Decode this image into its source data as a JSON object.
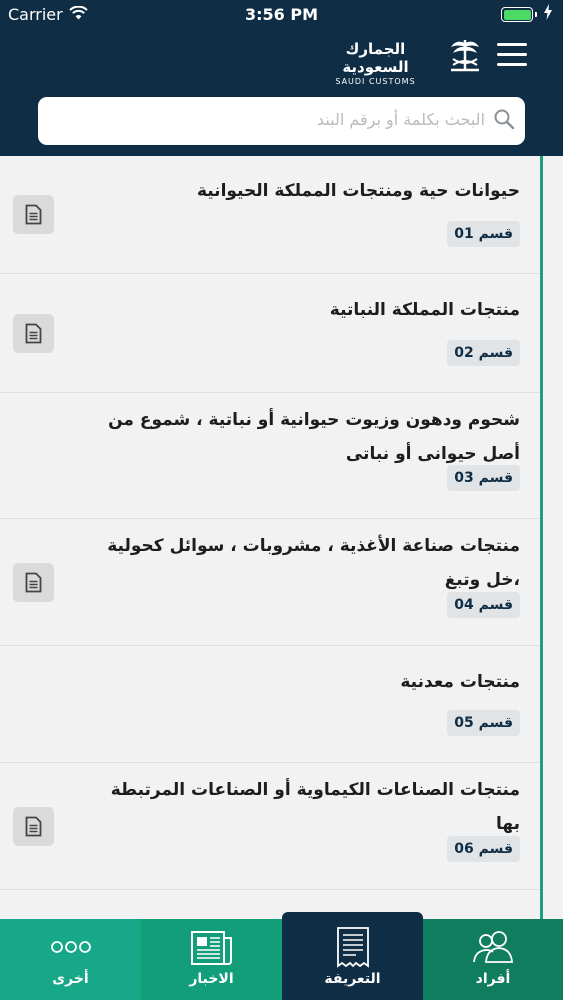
{
  "status_bar": {
    "carrier": "Carrier",
    "time": "3:56 PM",
    "battery_level": 1.0
  },
  "brand": {
    "name_ar": "الجمارك السعودية",
    "name_en": "SAUDI CUSTOMS"
  },
  "search": {
    "placeholder": "البحث بكلمة أو برقم البند"
  },
  "sections": [
    {
      "title": "حيوانات حية ومنتجات المملكة الحيوانية",
      "badge": "قسم 01",
      "has_doc": true
    },
    {
      "title": "منتجات المملكة النباتية",
      "badge": "قسم 02",
      "has_doc": true
    },
    {
      "title": "شحوم ودهون وزيوت حيوانية أو نباتية ، شموع من أصل حيوانى أو نباتى",
      "badge": "قسم 03",
      "has_doc": false
    },
    {
      "title": "منتجات صناعة الأغذية ، مشروبات ، سوائل كحولية ،خل وتبغ",
      "badge": "قسم 04",
      "has_doc": true
    },
    {
      "title": "منتجات معدنية",
      "badge": "قسم 05",
      "has_doc": false
    },
    {
      "title": "منتجات الصناعات الكيماوية أو الصناعات المرتبطة بها",
      "badge": "قسم 06",
      "has_doc": true
    }
  ],
  "tabs": [
    {
      "label": "أخرى",
      "icon": "more-dots-icon"
    },
    {
      "label": "الاخبار",
      "icon": "newspaper-icon"
    },
    {
      "label": "التعريفة",
      "icon": "tariff-document-icon",
      "selected": true
    },
    {
      "label": "أفراد",
      "icon": "people-icon"
    }
  ],
  "colors": {
    "header": "#0f2d44",
    "accent": "#1aa07d",
    "list_bg": "#f2f2f2"
  }
}
